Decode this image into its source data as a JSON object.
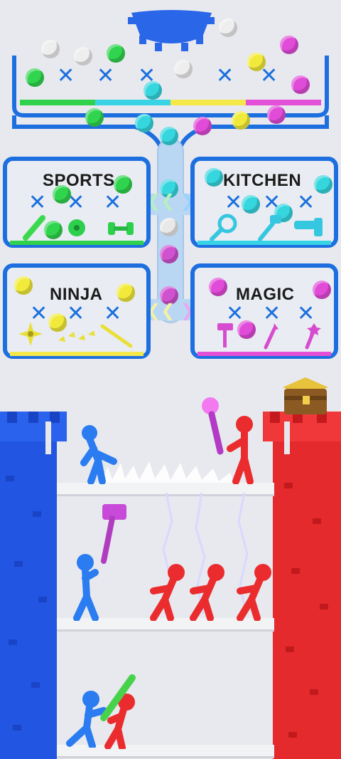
{
  "panels": [
    {
      "id": "sports",
      "label": "SPORTS",
      "bar_color": "#2fd24a",
      "items": [
        "baseball-bat",
        "soccer-ball",
        "dumbbell"
      ]
    },
    {
      "id": "kitchen",
      "label": "KITCHEN",
      "bar_color": "#39d3e6",
      "items": [
        "frying-pan",
        "spatula",
        "blender"
      ]
    },
    {
      "id": "ninja",
      "label": "NINJA",
      "bar_color": "#f5e94a",
      "items": [
        "shuriken",
        "kunai",
        "katana"
      ]
    },
    {
      "id": "magic",
      "label": "MAGIC",
      "bar_color": "#e34fd6",
      "items": [
        "hammer",
        "wand",
        "staff"
      ]
    }
  ],
  "colors": {
    "pipe": "#1d6fe0",
    "green": "#31d44f",
    "cyan": "#36d6de",
    "yellow": "#f2ea3b",
    "magenta": "#e04bd8",
    "white": "#eeeeee",
    "blue_team": "#1f5ee8",
    "red_team": "#ea2c30"
  },
  "top_bar_colors": [
    "#2fd24a",
    "#39d3e6",
    "#f5e94a",
    "#e34fd6"
  ],
  "icons": {
    "arrows_left": "triple-chevron-left",
    "arrows_right": "triple-chevron-right",
    "chest": "treasure-chest"
  }
}
